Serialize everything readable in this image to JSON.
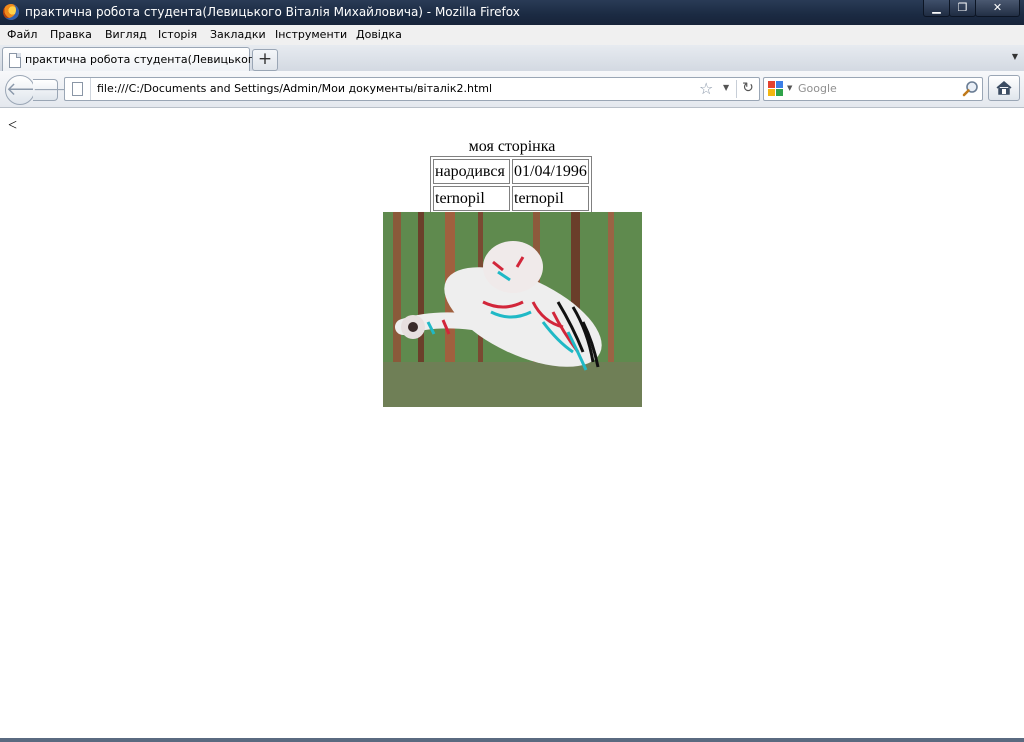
{
  "window": {
    "title": "практична робота студента(Левицького Віталія Михайловича) - Mozilla Firefox",
    "controls": {
      "minimize": "▁",
      "restore": "❐",
      "close": "✕"
    }
  },
  "menu": {
    "items": [
      "Файл",
      "Правка",
      "Вигляд",
      "Історія",
      "Закладки",
      "Інструменти",
      "Довідка"
    ]
  },
  "tabs": {
    "active_label": "практична робота студента(Левицьког...",
    "new_tab": "+"
  },
  "navigation": {
    "back": "🡐",
    "forward": "🡒",
    "url": "file:///C:/Documents and Settings/Admin/Мои документы/віталік2.html",
    "bookmark_star": "☆",
    "reload": "↻",
    "search_placeholder": "Google"
  },
  "page": {
    "stray_text": "<",
    "title": "моя сторінка",
    "table": [
      [
        "народився",
        "01/04/1996"
      ],
      [
        "ternopil",
        "ternopil"
      ]
    ]
  },
  "colors": {
    "titlebar": "#1b2a42",
    "menubar": "#f0f0f0",
    "link": "#000000"
  }
}
